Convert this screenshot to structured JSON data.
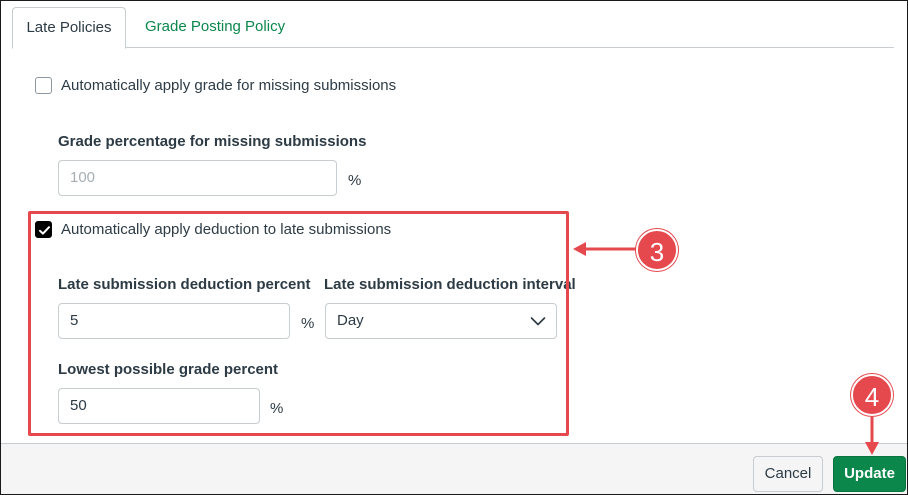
{
  "tabs": [
    {
      "label": "Late Policies",
      "active": true
    },
    {
      "label": "Grade Posting Policy",
      "active": false
    }
  ],
  "missing": {
    "checkbox_label": "Automatically apply grade for missing submissions",
    "checked": false,
    "grade_label": "Grade percentage for missing submissions",
    "grade_value": "100",
    "unit": "%"
  },
  "late": {
    "checkbox_label": "Automatically apply deduction to late submissions",
    "checked": true,
    "deduction_label": "Late submission deduction percent",
    "deduction_value": "5",
    "deduction_unit": "%",
    "interval_label": "Late submission deduction interval",
    "interval_value": "Day",
    "lowest_label": "Lowest possible grade percent",
    "lowest_value": "50",
    "lowest_unit": "%"
  },
  "annotations": {
    "callout_3": "3",
    "callout_4": "4",
    "color": "#e5484d"
  },
  "footer": {
    "cancel_label": "Cancel",
    "update_label": "Update"
  },
  "colors": {
    "accent": "#0b874b",
    "text": "#2d3b45"
  }
}
